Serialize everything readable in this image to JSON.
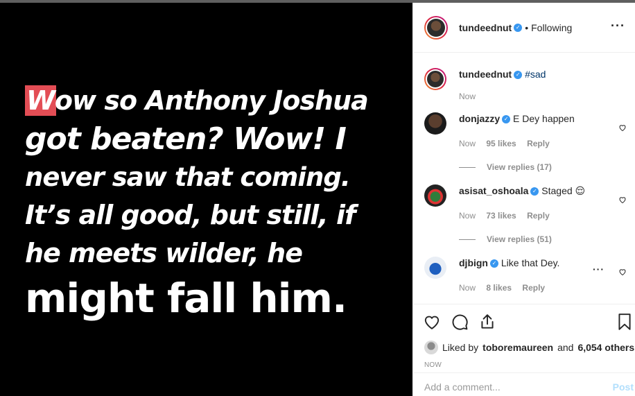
{
  "story": {
    "highlight_letter": "W",
    "lines": [
      "ow so Anthony Joshua",
      "got beaten? Wow! I",
      "never saw that coming.",
      "It’s all good, but still, if",
      "he meets wilder, he",
      "might fall him."
    ],
    "highlight_color": "#e34d55"
  },
  "header": {
    "username": "tundeednut",
    "separator": "•",
    "follow_status": "Following",
    "more_icon": "more-horizontal-icon"
  },
  "caption": {
    "username": "tundeednut",
    "hashtag": "#sad",
    "time": "Now"
  },
  "comments": [
    {
      "username": "donjazzy",
      "text": "E Dey happen",
      "time": "Now",
      "likes": "95 likes",
      "reply": "Reply",
      "view_replies": "View replies (17)"
    },
    {
      "username": "asisat_oshoala",
      "text": "Staged 😌",
      "time": "Now",
      "likes": "73 likes",
      "reply": "Reply",
      "view_replies": "View replies (51)"
    },
    {
      "username": "djbign",
      "text": "Like that Dey.",
      "time": "Now",
      "likes": "8 likes",
      "reply": "Reply",
      "more": "···"
    }
  ],
  "actions": {
    "liked_by_prefix": "Liked by",
    "liked_by_user": "toboremaureen",
    "liked_by_suffix": "and",
    "others": "6,054 others",
    "timestamp": "NOW"
  },
  "add_comment": {
    "placeholder": "Add a comment...",
    "post_label": "Post"
  },
  "colors": {
    "verified": "#3897f0",
    "link_blue": "#003569",
    "muted": "#8e8e8e",
    "post_disabled": "#b2dffc"
  }
}
